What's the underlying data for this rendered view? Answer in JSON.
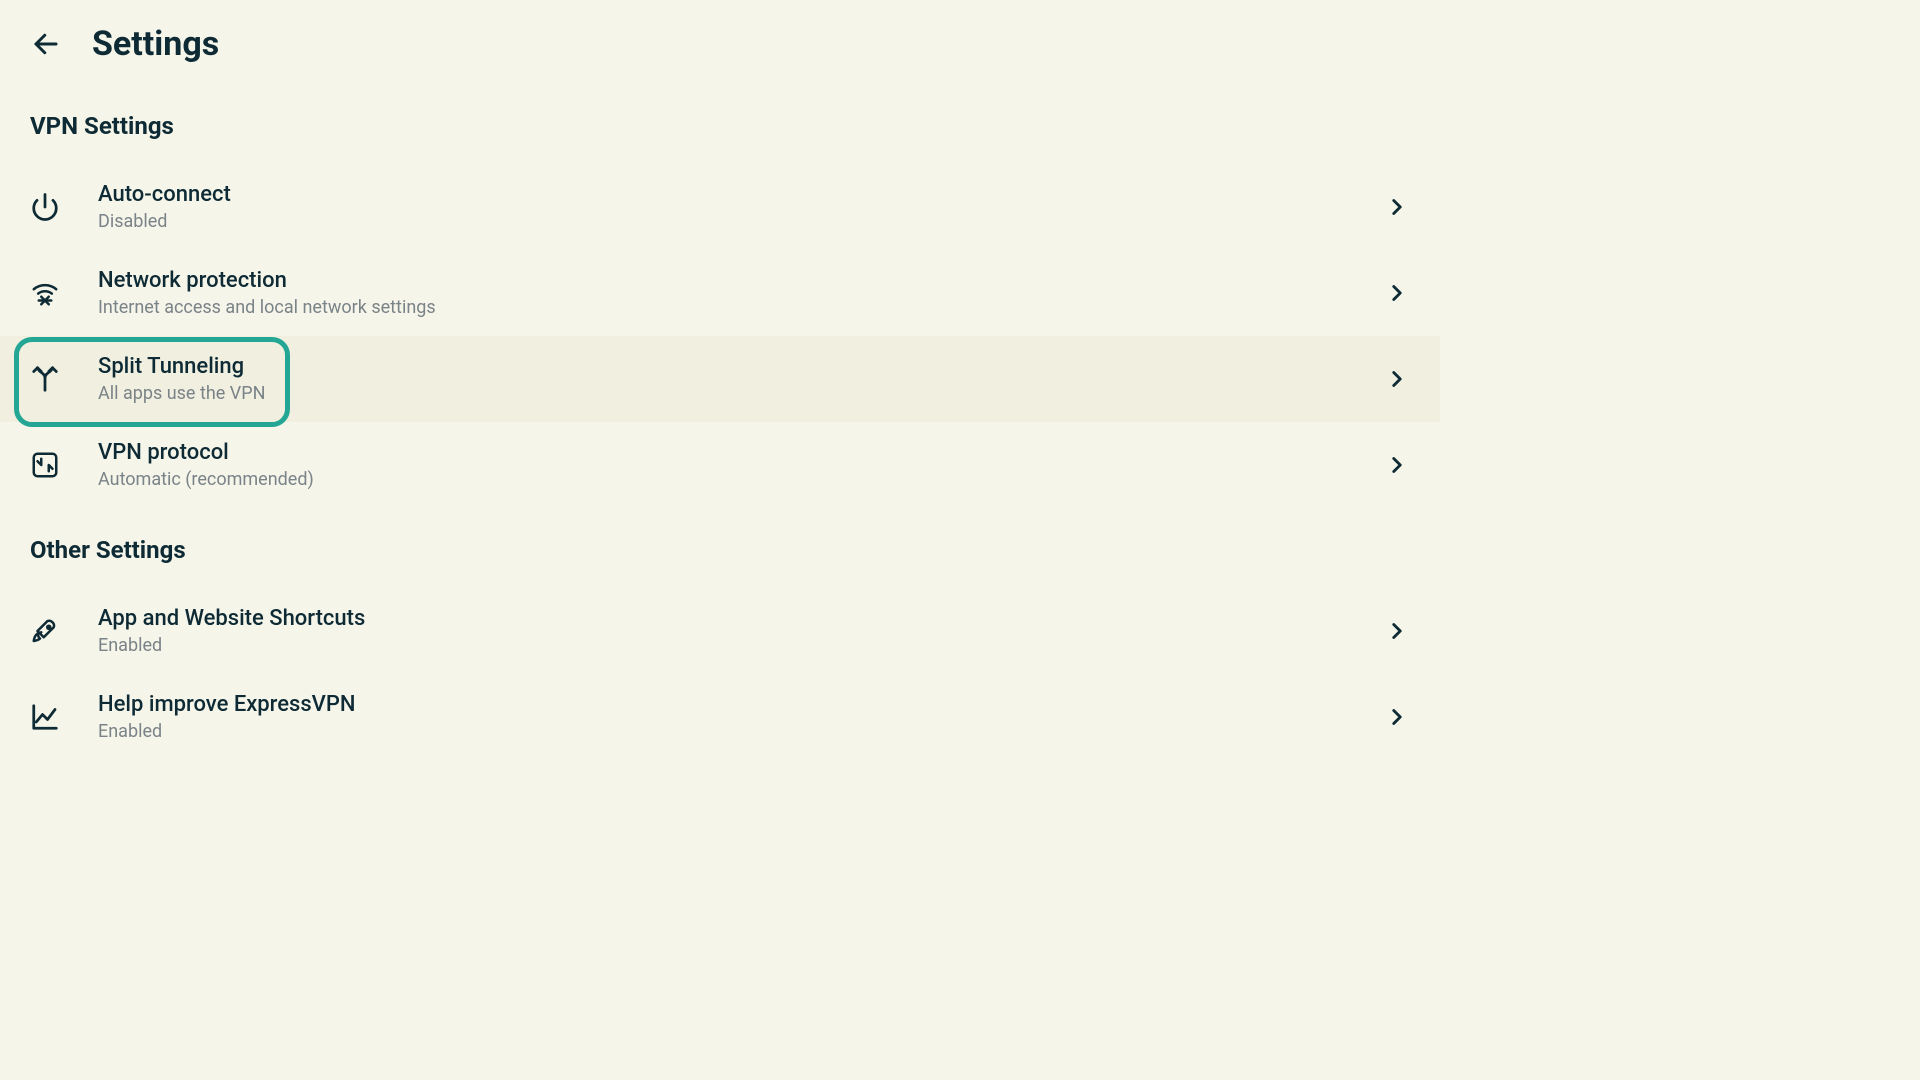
{
  "header": {
    "title": "Settings"
  },
  "sections": [
    {
      "label": "VPN Settings",
      "items": [
        {
          "title": "Auto-connect",
          "subtitle": "Disabled"
        },
        {
          "title": "Network protection",
          "subtitle": "Internet access and local network settings"
        },
        {
          "title": "Split Tunneling",
          "subtitle": "All apps use the VPN"
        },
        {
          "title": "VPN protocol",
          "subtitle": "Automatic (recommended)"
        }
      ]
    },
    {
      "label": "Other Settings",
      "items": [
        {
          "title": "App and Website Shortcuts",
          "subtitle": "Enabled"
        },
        {
          "title": "Help improve ExpressVPN",
          "subtitle": "Enabled"
        }
      ]
    }
  ],
  "colors": {
    "accent": "#23a693"
  }
}
